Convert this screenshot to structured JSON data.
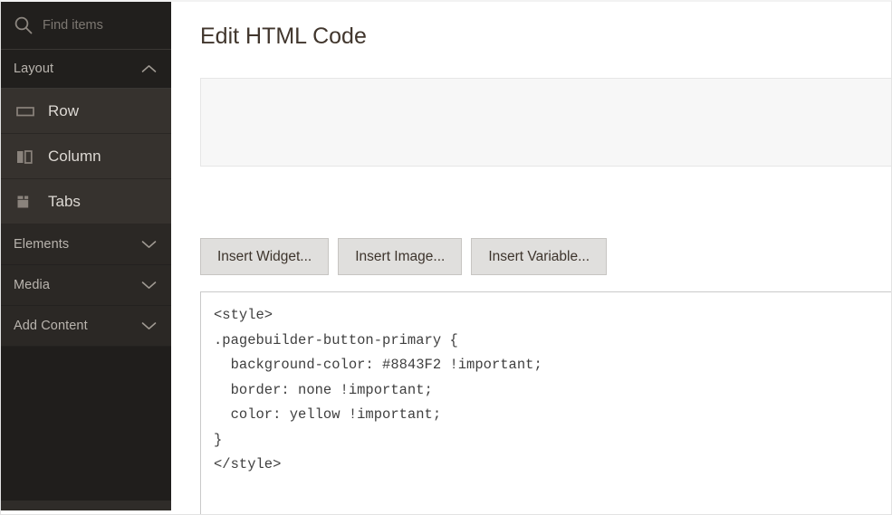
{
  "sidebar": {
    "search": {
      "placeholder": "Find items",
      "value": "",
      "icon": "search-icon"
    },
    "groups": [
      {
        "label": "Layout",
        "expanded": true,
        "chevron": "chevron-up-icon",
        "items": [
          {
            "label": "Row",
            "icon": "row-icon"
          },
          {
            "label": "Column",
            "icon": "column-icon"
          },
          {
            "label": "Tabs",
            "icon": "tabs-icon"
          }
        ]
      },
      {
        "label": "Elements",
        "expanded": false,
        "chevron": "chevron-down-icon",
        "items": []
      },
      {
        "label": "Media",
        "expanded": false,
        "chevron": "chevron-down-icon",
        "items": []
      },
      {
        "label": "Add Content",
        "expanded": false,
        "chevron": "chevron-down-icon",
        "items": []
      }
    ],
    "colors": {
      "background": "#2f2c29",
      "header_background": "#211f1d",
      "item_background": "#36322e",
      "label": "#b9b4ae",
      "item_label": "#dcd8d3"
    }
  },
  "main": {
    "title": "Edit HTML Code",
    "preview": {
      "content": ""
    },
    "buttons": [
      {
        "label": "Insert Widget..."
      },
      {
        "label": "Insert Image..."
      },
      {
        "label": "Insert Variable..."
      }
    ],
    "editor": {
      "value": "<style>\n.pagebuilder-button-primary {\n  background-color: #8843F2 !important;\n  border: none !important;\n  color: yellow !important;\n}\n</style>",
      "placeholder": ""
    },
    "colors": {
      "title": "#41362d",
      "button_background": "#e0dfdd",
      "button_border": "#c7c5c2",
      "preview_background": "#f7f7f7",
      "editor_border": "#c9c9c9",
      "code_text": "#3f3f3f"
    }
  }
}
